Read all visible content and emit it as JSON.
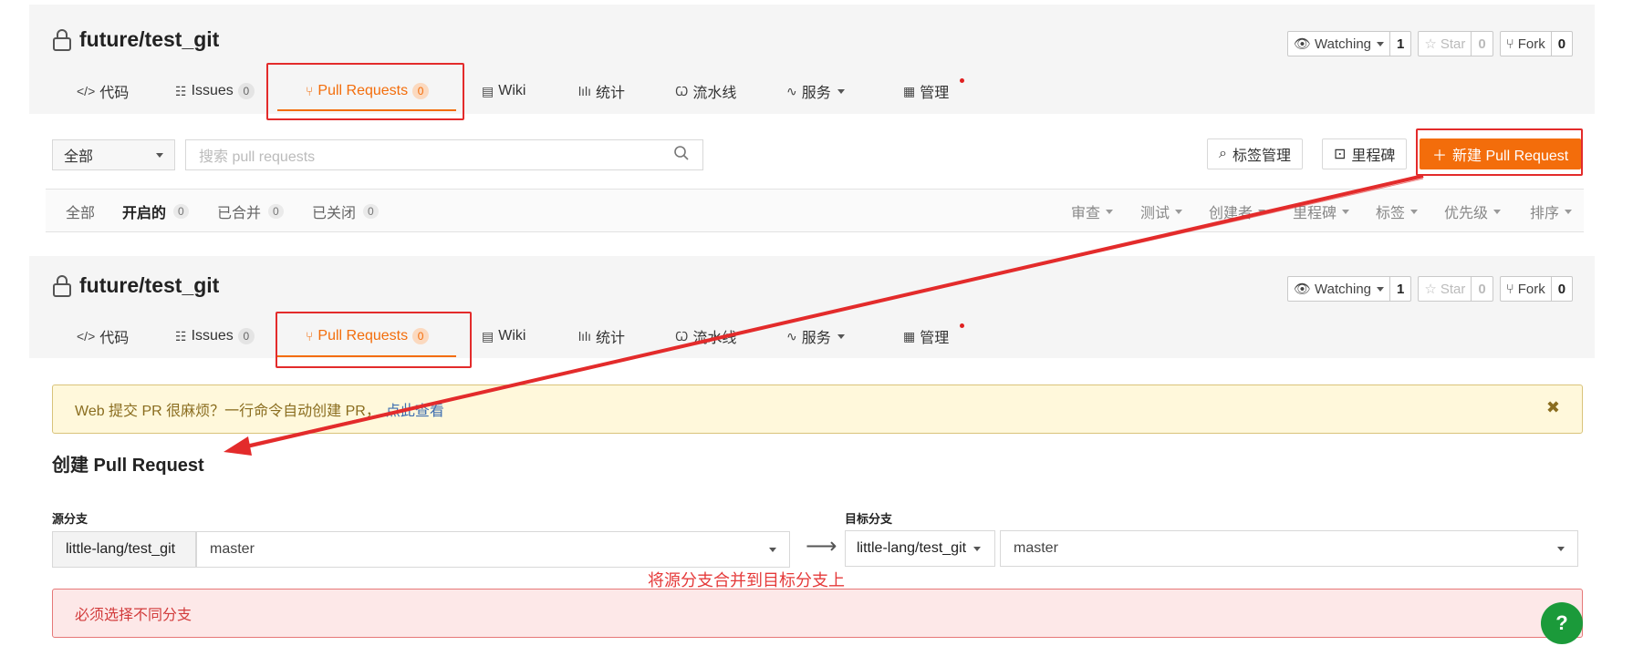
{
  "repo": {
    "name": "future/test_git",
    "watch": {
      "label": "Watching",
      "count": "1"
    },
    "star": {
      "label": "Star",
      "count": "0"
    },
    "fork": {
      "label": "Fork",
      "count": "0"
    }
  },
  "tabs": [
    {
      "icon": "</>",
      "label": "代码"
    },
    {
      "icon": "☷",
      "label": "Issues",
      "badge": "0"
    },
    {
      "icon": "⑂",
      "label": "Pull Requests",
      "badge": "0"
    },
    {
      "icon": "▤",
      "label": "Wiki"
    },
    {
      "icon": "lılı",
      "label": "统计"
    },
    {
      "icon": "Ꞷ",
      "label": "流水线"
    },
    {
      "icon": "∿",
      "label": "服务"
    },
    {
      "icon": "▦",
      "label": "管理"
    }
  ],
  "filter": {
    "scope_select": "全部",
    "search_placeholder": "搜索 pull requests",
    "label_manage": "标签管理",
    "milestone": "里程碑",
    "new_pr": "新建 Pull Request"
  },
  "states": [
    {
      "label": "全部"
    },
    {
      "label": "开启的",
      "count": "0"
    },
    {
      "label": "已合并",
      "count": "0"
    },
    {
      "label": "已关闭",
      "count": "0"
    }
  ],
  "sorters": [
    "审查",
    "测试",
    "创建者",
    "里程碑",
    "标签",
    "优先级",
    "排序"
  ],
  "notice": {
    "text": "Web 提交 PR 很麻烦？一行命令自动创建 PR，",
    "link": "点此查看",
    "close": "✖"
  },
  "create": {
    "title": "创建 Pull Request",
    "source_label": "源分支",
    "target_label": "目标分支",
    "source_repo": "little-lang/test_git",
    "source_branch": "master",
    "target_repo": "little-lang/test_git",
    "target_branch": "master",
    "arrow": "⟶",
    "annotation": "将源分支合并到目标分支上",
    "error": "必须选择不同分支"
  },
  "help": "?",
  "colors": {
    "accent": "#f36d0b",
    "highlight": "#e32b2b",
    "help": "#1b9a3a"
  }
}
